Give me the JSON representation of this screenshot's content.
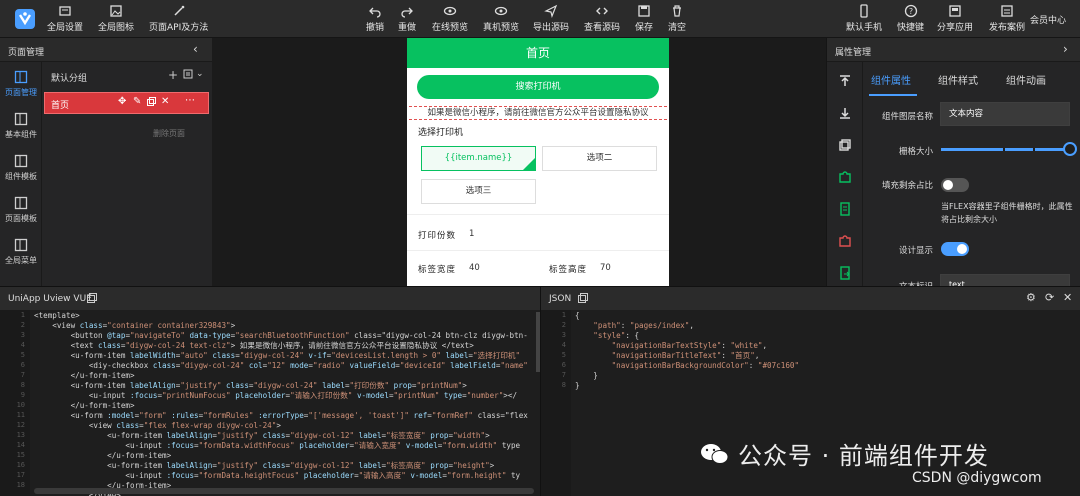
{
  "toolbar": {
    "left": [
      {
        "label": "全局设置",
        "icon": "settings-icon"
      },
      {
        "label": "全局图标",
        "icon": "image-icon"
      },
      {
        "label": "页面API及方法",
        "icon": "magic-icon"
      }
    ],
    "center": [
      {
        "label": "撤销",
        "icon": "undo-icon"
      },
      {
        "label": "重做",
        "icon": "redo-icon"
      },
      {
        "label": "在线预览",
        "icon": "eye-icon"
      },
      {
        "label": "真机预览",
        "icon": "eye-icon"
      },
      {
        "label": "导出源码",
        "icon": "send-icon"
      },
      {
        "label": "查看源码",
        "icon": "code-icon"
      },
      {
        "label": "保存",
        "icon": "save-icon"
      },
      {
        "label": "清空",
        "icon": "trash-icon"
      }
    ],
    "right": [
      {
        "label": "默认手机",
        "icon": "phone-icon"
      },
      {
        "label": "快捷键",
        "icon": "help-icon"
      },
      {
        "label": "分享应用",
        "icon": "share-icon"
      },
      {
        "label": "发布案例",
        "icon": "publish-icon"
      }
    ],
    "member_label": "会员中心"
  },
  "left_panel": {
    "title": "页面管理",
    "rail": [
      "页面管理",
      "基本组件",
      "组件模板",
      "页面模板",
      "全局菜单"
    ],
    "group_name": "默认分组",
    "page_name": "首页",
    "delete_label": "删除页面"
  },
  "phone": {
    "nav_title": "首页",
    "search_button": "搜索打印机",
    "privacy_text": "如果是微信小程序，请前往微信官方公众平台设置隐私协议",
    "printer_label": "选择打印机",
    "options": [
      "{{item.name}}",
      "选项二",
      "选项三"
    ],
    "copies_label": "打印份数",
    "copies_value": "1",
    "width_label": "标签宽度",
    "width_value": "40",
    "height_label": "标签高度",
    "height_value": "70"
  },
  "right_panel": {
    "title": "属性管理",
    "tabs": [
      "组件属性",
      "组件样式",
      "组件动画"
    ],
    "name_label": "组件图层名称",
    "name_value": "文本内容",
    "grid_label": "栅格大小",
    "fill_label": "填充剩余占比",
    "flex_desc": "当FLEX容器里子组件栅格时，此属性将占比剩余大小",
    "display_label": "设计显示",
    "text_label": "文本标识",
    "text_value": "text",
    "colors": {
      "accent": "#4a9eff",
      "green": "#07c160",
      "red": "#d9383c"
    }
  },
  "code_left": {
    "title": "UniApp Uview VUE",
    "lines": [
      "<template>",
      "    <view class=\"container container329843\">",
      "        <button @tap=\"navigateTo\" data-type=\"searchBluetoothFunction\" class=\"diygw-col-24 btn-clz diygw-btn-",
      "        <text class=\"diygw-col-24 text-clz\"> 如果是微信小程序，请前往微信官方公众平台设置隐私协议 </text>",
      "        <u-form-item labelWidth=\"auto\" class=\"diygw-col-24\" v-if=\"devicesList.length > 0\" label=\"选择打印机\"",
      "            <diy-checkbox class=\"diygw-col-24\" col=\"12\" mode=\"radio\" valueField=\"deviceId\" labelField=\"name\"",
      "        </u-form-item>",
      "        <u-form-item labelAlign=\"justify\" class=\"diygw-col-24\" label=\"打印份数\" prop=\"printNum\">",
      "            <u-input :focus=\"printNumFocus\" placeholder=\"请输入打印份数\" v-model=\"printNum\" type=\"number\"></",
      "        </u-form-item>",
      "        <u-form :model=\"form\" :rules=\"formRules\" :errorType=\"['message', 'toast']\" ref=\"formRef\" class=\"flex",
      "            <view class=\"flex flex-wrap diygw-col-24\">",
      "                <u-form-item labelAlign=\"justify\" class=\"diygw-col-12\" label=\"标签宽度\" prop=\"width\">",
      "                    <u-input :focus=\"formData.widthFocus\" placeholder=\"请输入宽度\" v-model=\"form.width\" type",
      "                </u-form-item>",
      "                <u-form-item labelAlign=\"justify\" class=\"diygw-col-12\" label=\"标签高度\" prop=\"height\">",
      "                    <u-input :focus=\"formData.heightFocus\" placeholder=\"请输入高度\" v-model=\"form.height\" ty",
      "                </u-form-item>",
      "            </view>"
    ]
  },
  "code_right": {
    "title": "JSON",
    "lines": [
      "{",
      "    \"path\": \"pages/index\",",
      "    \"style\": {",
      "        \"navigationBarTextStyle\": \"white\",",
      "        \"navigationBarTitleText\": \"首页\",",
      "        \"navigationBarBackgroundColor\": \"#07c160\"",
      "    }",
      "}"
    ]
  },
  "watermark": {
    "main": "公众号 · 前端组件开发",
    "sub": "CSDN @diygwcom"
  }
}
